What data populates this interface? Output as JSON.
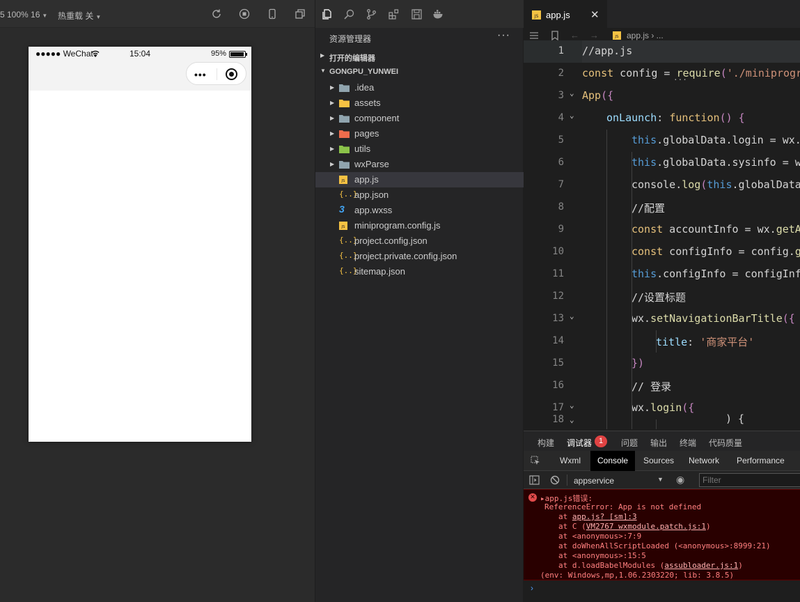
{
  "simulator": {
    "zoom_label": "5 100% 16",
    "hot_reload_label": "热重载 关",
    "status": {
      "carrier": "●●●●● WeChat",
      "time": "15:04",
      "battery": "95%"
    }
  },
  "explorer": {
    "title": "资源管理器",
    "more": "···",
    "open_editors": "打开的编辑器",
    "project": "GONGPU_YUNWEI",
    "items": [
      {
        "name": ".idea",
        "type": "folder",
        "color": "#90a4ae"
      },
      {
        "name": "assets",
        "type": "folder",
        "color": "#f6c243"
      },
      {
        "name": "component",
        "type": "folder",
        "color": "#90a4ae"
      },
      {
        "name": "pages",
        "type": "folder",
        "color": "#ef6c4c"
      },
      {
        "name": "utils",
        "type": "folder",
        "color": "#8bc34a"
      },
      {
        "name": "wxParse",
        "type": "folder",
        "color": "#90a4ae"
      },
      {
        "name": "app.js",
        "type": "js",
        "color": "#f6c243"
      },
      {
        "name": "app.json",
        "type": "json",
        "color": "#f6c243"
      },
      {
        "name": "app.wxss",
        "type": "wxss",
        "color": "#42a5f5"
      },
      {
        "name": "miniprogram.config.js",
        "type": "js",
        "color": "#f6c243"
      },
      {
        "name": "project.config.json",
        "type": "json",
        "color": "#f6c243"
      },
      {
        "name": "project.private.config.json",
        "type": "json",
        "color": "#f6c243"
      },
      {
        "name": "sitemap.json",
        "type": "json",
        "color": "#f6c243"
      }
    ]
  },
  "editor": {
    "tab_label": "app.js",
    "tab_close": "✕",
    "breadcrumb": "app.js › ...",
    "lines": [
      {
        "n": "1",
        "text": "//app.js"
      },
      {
        "n": "2",
        "text": "const config = require('./miniprogra"
      },
      {
        "n": "3",
        "text": "App({"
      },
      {
        "n": "4",
        "text": "onLaunch: function() {"
      },
      {
        "n": "5",
        "text": "this.globalData.login = wx.g"
      },
      {
        "n": "6",
        "text": "this.globalData.sysinfo = wx"
      },
      {
        "n": "7",
        "text": "console.log(this.globalData."
      },
      {
        "n": "8",
        "text": "//配置"
      },
      {
        "n": "9",
        "text": "const accountInfo = wx.getAc"
      },
      {
        "n": "10",
        "text": "const configInfo = config.ge"
      },
      {
        "n": "11",
        "text": "this.configInfo = configInfo"
      },
      {
        "n": "12",
        "text": "//设置标题"
      },
      {
        "n": "13",
        "text": "wx.setNavigationBarTitle({"
      },
      {
        "n": "14",
        "text": "title: '商家平台'"
      },
      {
        "n": "15",
        "text": "})"
      },
      {
        "n": "16",
        "text": "// 登录"
      },
      {
        "n": "17",
        "text": "wx.login({"
      }
    ]
  },
  "debug": {
    "tabs": [
      "构建",
      "调试器",
      "问题",
      "输出",
      "终端",
      "代码质量"
    ],
    "badge": "1",
    "devtools_tabs": [
      "Wxml",
      "Console",
      "Sources",
      "Network",
      "Performance"
    ],
    "context": "appservice",
    "filter_placeholder": "Filter",
    "error": {
      "head": "▸app.js错误:",
      "message": "ReferenceError: App is not defined",
      "stack": [
        {
          "pre": "at ",
          "link": "app.js? [sm]:3",
          "post": ""
        },
        {
          "pre": "at C (",
          "link": "VM2767 wxmodule.patch.js:1",
          "post": ")"
        },
        {
          "pre": "at <anonymous>:7:9",
          "link": "",
          "post": ""
        },
        {
          "pre": "at doWhenAllScriptLoaded (<anonymous>:8999:21)",
          "link": "",
          "post": ""
        },
        {
          "pre": "at <anonymous>:15:5",
          "link": "",
          "post": ""
        },
        {
          "pre": "at d.loadBabelModules (",
          "link": "assubloader.js:1",
          "post": ")"
        }
      ],
      "env": "(env: Windows,mp,1.06.2303220; lib: 3.8.5)"
    },
    "prompt": "›"
  }
}
